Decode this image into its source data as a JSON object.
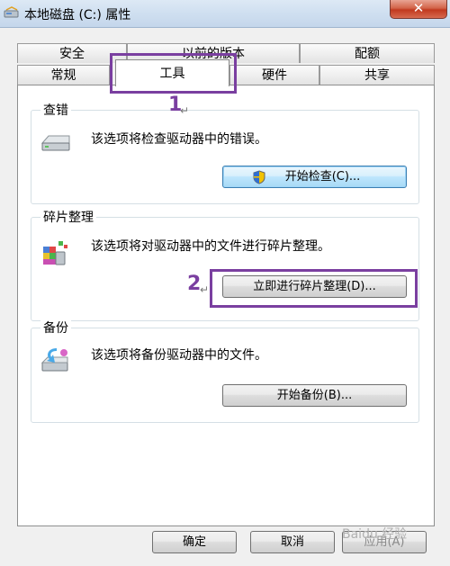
{
  "window": {
    "title": "本地磁盘 (C:) 属性",
    "close_symbol": "✕"
  },
  "tabs": {
    "row1": [
      "安全",
      "以前的版本",
      "配额"
    ],
    "row2": [
      "常规",
      "工具",
      "硬件",
      "共享"
    ],
    "active": "工具"
  },
  "sections": {
    "error_check": {
      "label": "查错",
      "description": "该选项将检查驱动器中的错误。",
      "button": "开始检查(C)...",
      "icon": "drive-icon"
    },
    "defrag": {
      "label": "碎片整理",
      "description": "该选项将对驱动器中的文件进行碎片整理。",
      "button": "立即进行碎片整理(D)...",
      "icon": "defrag-icon"
    },
    "backup": {
      "label": "备份",
      "description": "该选项将备份驱动器中的文件。",
      "button": "开始备份(B)...",
      "icon": "backup-icon"
    }
  },
  "footer": {
    "ok": "确定",
    "cancel": "取消",
    "apply": "应用(A)"
  },
  "annotations": {
    "step1": "1",
    "step2": "2",
    "paragraph_mark": "↵",
    "color": "#7a3fa0"
  },
  "watermark": "Baidu 经验"
}
